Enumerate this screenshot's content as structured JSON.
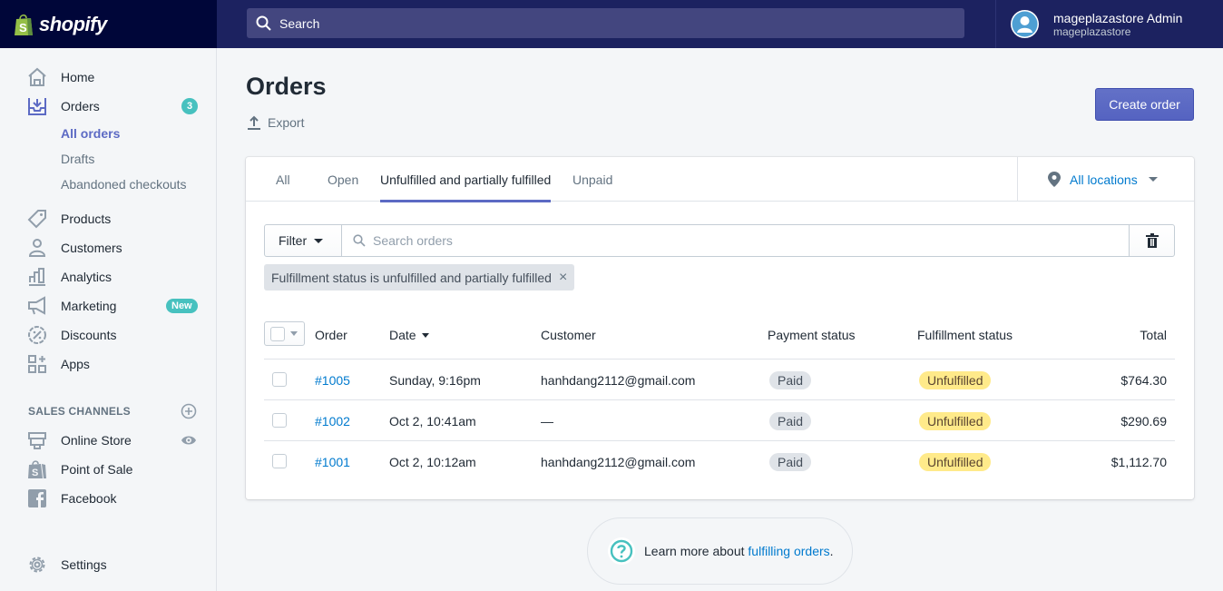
{
  "topbar": {
    "brand": "shopify",
    "search_placeholder": "Search",
    "account_name": "mageplazastore Admin",
    "store_name": "mageplazastore"
  },
  "sidebar": {
    "items": [
      {
        "label": "Home",
        "icon": "home-icon"
      },
      {
        "label": "Orders",
        "icon": "orders-icon",
        "badge": "3"
      },
      {
        "label": "Products",
        "icon": "tag-icon"
      },
      {
        "label": "Customers",
        "icon": "person-icon"
      },
      {
        "label": "Analytics",
        "icon": "bar-chart-icon"
      },
      {
        "label": "Marketing",
        "icon": "megaphone-icon",
        "badge": "New"
      },
      {
        "label": "Discounts",
        "icon": "discount-icon"
      },
      {
        "label": "Apps",
        "icon": "apps-icon"
      }
    ],
    "orders_sub": [
      {
        "label": "All orders",
        "active": true
      },
      {
        "label": "Drafts"
      },
      {
        "label": "Abandoned checkouts"
      }
    ],
    "sales_channels_heading": "SALES CHANNELS",
    "channels": [
      {
        "label": "Online Store",
        "icon": "store-icon"
      },
      {
        "label": "Point of Sale",
        "icon": "shopify-bag-icon"
      },
      {
        "label": "Facebook",
        "icon": "facebook-icon"
      }
    ],
    "settings_label": "Settings"
  },
  "page": {
    "title": "Orders",
    "export_label": "Export",
    "create_order_label": "Create order"
  },
  "tabs": [
    {
      "label": "All"
    },
    {
      "label": "Open"
    },
    {
      "label": "Unfulfilled and partially fulfilled",
      "active": true
    },
    {
      "label": "Unpaid"
    }
  ],
  "location_filter": "All locations",
  "filter": {
    "button_label": "Filter",
    "search_placeholder": "Search orders",
    "applied_tag": "Fulfillment status is unfulfilled and partially fulfilled"
  },
  "table": {
    "columns": [
      "Order",
      "Date",
      "Customer",
      "Payment status",
      "Fulfillment status",
      "Total"
    ],
    "rows": [
      {
        "order": "#1005",
        "date": "Sunday, 9:16pm",
        "customer": "hanhdang2112@gmail.com",
        "payment": "Paid",
        "fulfillment": "Unfulfilled",
        "total": "$764.30"
      },
      {
        "order": "#1002",
        "date": "Oct 2, 10:41am",
        "customer": "—",
        "payment": "Paid",
        "fulfillment": "Unfulfilled",
        "total": "$290.69"
      },
      {
        "order": "#1001",
        "date": "Oct 2, 10:12am",
        "customer": "hanhdang2112@gmail.com",
        "payment": "Paid",
        "fulfillment": "Unfulfilled",
        "total": "$1,112.70"
      }
    ]
  },
  "help": {
    "text": "Learn more about ",
    "link": "fulfilling orders",
    "suffix": "."
  },
  "colors": {
    "accent": "#5c6ac4",
    "topbar": "#1c2260",
    "link": "#007ace",
    "badge_teal": "#47c1bf",
    "unfulfilled": "#ffea8a"
  }
}
